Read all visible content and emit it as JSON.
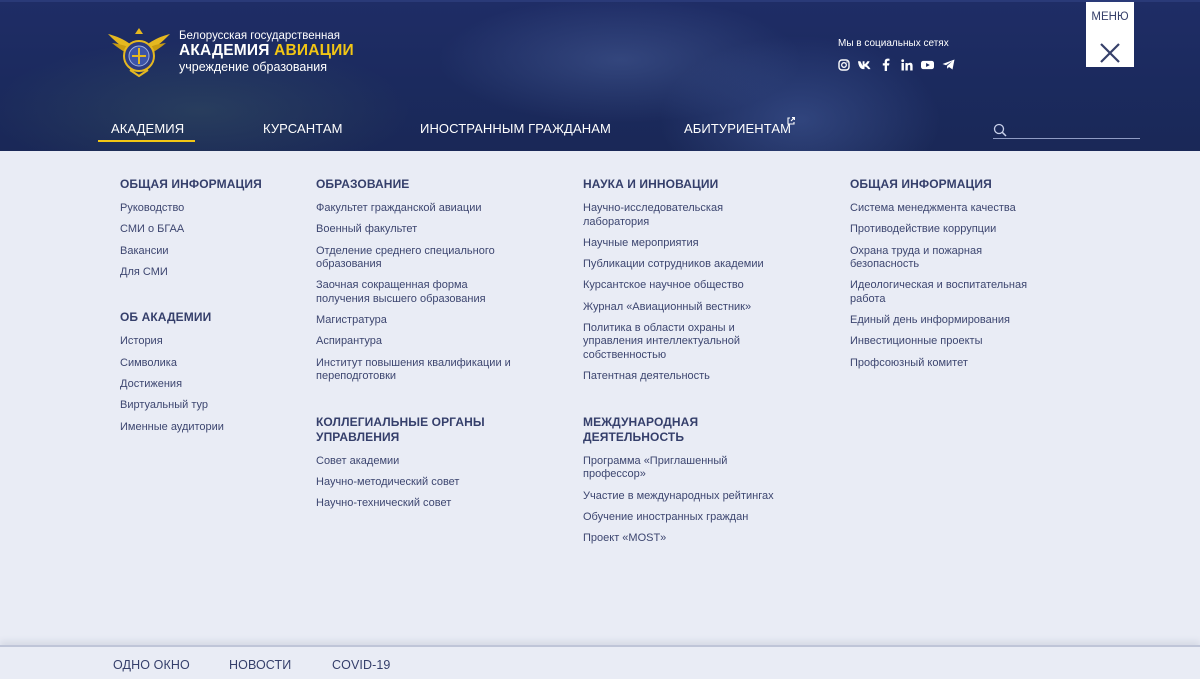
{
  "brand": {
    "line1": "Белорусская государственная",
    "line2a": "АКАДЕМИЯ",
    "line2b": "АВИАЦИИ",
    "line3": "учреждение образования"
  },
  "colors": {
    "header_bg": "#1b2a5e",
    "accent": "#f2c614",
    "menu_bg": "#e9ecf5",
    "text": "#353f6b"
  },
  "social": {
    "title": "Мы в социальных сетях",
    "icons": [
      "instagram-icon",
      "vk-icon",
      "facebook-icon",
      "linkedin-icon",
      "youtube-icon",
      "telegram-icon"
    ]
  },
  "menu_button": {
    "label": "МЕНЮ"
  },
  "nav": [
    {
      "label": "АКАДЕМИЯ",
      "active": true
    },
    {
      "label": "КУРСАНТАМ"
    },
    {
      "label": "ИНОСТРАННЫМ ГРАЖДАНАМ"
    },
    {
      "label": "АБИТУРИЕНТАМ",
      "external": true
    }
  ],
  "search": {
    "value": "",
    "placeholder": ""
  },
  "columns": [
    {
      "groups": [
        {
          "title": "ОБЩАЯ ИНФОРМАЦИЯ",
          "items": [
            "Руководство",
            "СМИ о БГАА",
            "Вакансии",
            "Для СМИ"
          ]
        },
        {
          "title": "ОБ АКАДЕМИИ",
          "items": [
            "История",
            "Символика",
            "Достижения",
            "Виртуальный тур",
            "Именные аудитории"
          ]
        }
      ]
    },
    {
      "groups": [
        {
          "title": "ОБРАЗОВАНИЕ",
          "items": [
            "Факультет гражданской авиации",
            "Военный факультет",
            "Отделение среднего специального образования",
            "Заочная сокращенная форма получения высшего образования",
            "Магистратура",
            "Аспирантура",
            "Институт повышения квалификации и переподготовки"
          ]
        },
        {
          "title": "КОЛЛЕГИАЛЬНЫЕ ОРГАНЫ УПРАВЛЕНИЯ",
          "items": [
            "Совет академии",
            "Научно-методический совет",
            "Научно-технический совет"
          ]
        }
      ]
    },
    {
      "groups": [
        {
          "title": "НАУКА И ИННОВАЦИИ",
          "items": [
            "Научно-исследовательская лаборатория",
            "Научные мероприятия",
            "Публикации сотрудников академии",
            "Курсантское научное общество",
            "Журнал «Авиационный вестник»",
            "Политика в области охраны и управления интеллектуальной собственностью",
            "Патентная деятельность"
          ]
        },
        {
          "title": "МЕЖДУНАРОДНАЯ ДЕЯТЕЛЬНОСТЬ",
          "items": [
            "Программа «Приглашенный профессор»",
            "Участие в международных рейтингах",
            "Обучение иностранных граждан",
            "Проект «MOST»"
          ]
        }
      ]
    },
    {
      "groups": [
        {
          "title": "ОБЩАЯ ИНФОРМАЦИЯ",
          "items": [
            "Система менеджмента качества",
            "Противодействие коррупции",
            "Охрана труда и пожарная безопасность",
            "Идеологическая и воспитательная работа",
            "Единый день информирования",
            "Инвестиционные проекты",
            "Профсоюзный комитет"
          ]
        }
      ]
    }
  ],
  "footer": [
    "ОДНО ОКНО",
    "НОВОСТИ",
    "COVID-19"
  ]
}
